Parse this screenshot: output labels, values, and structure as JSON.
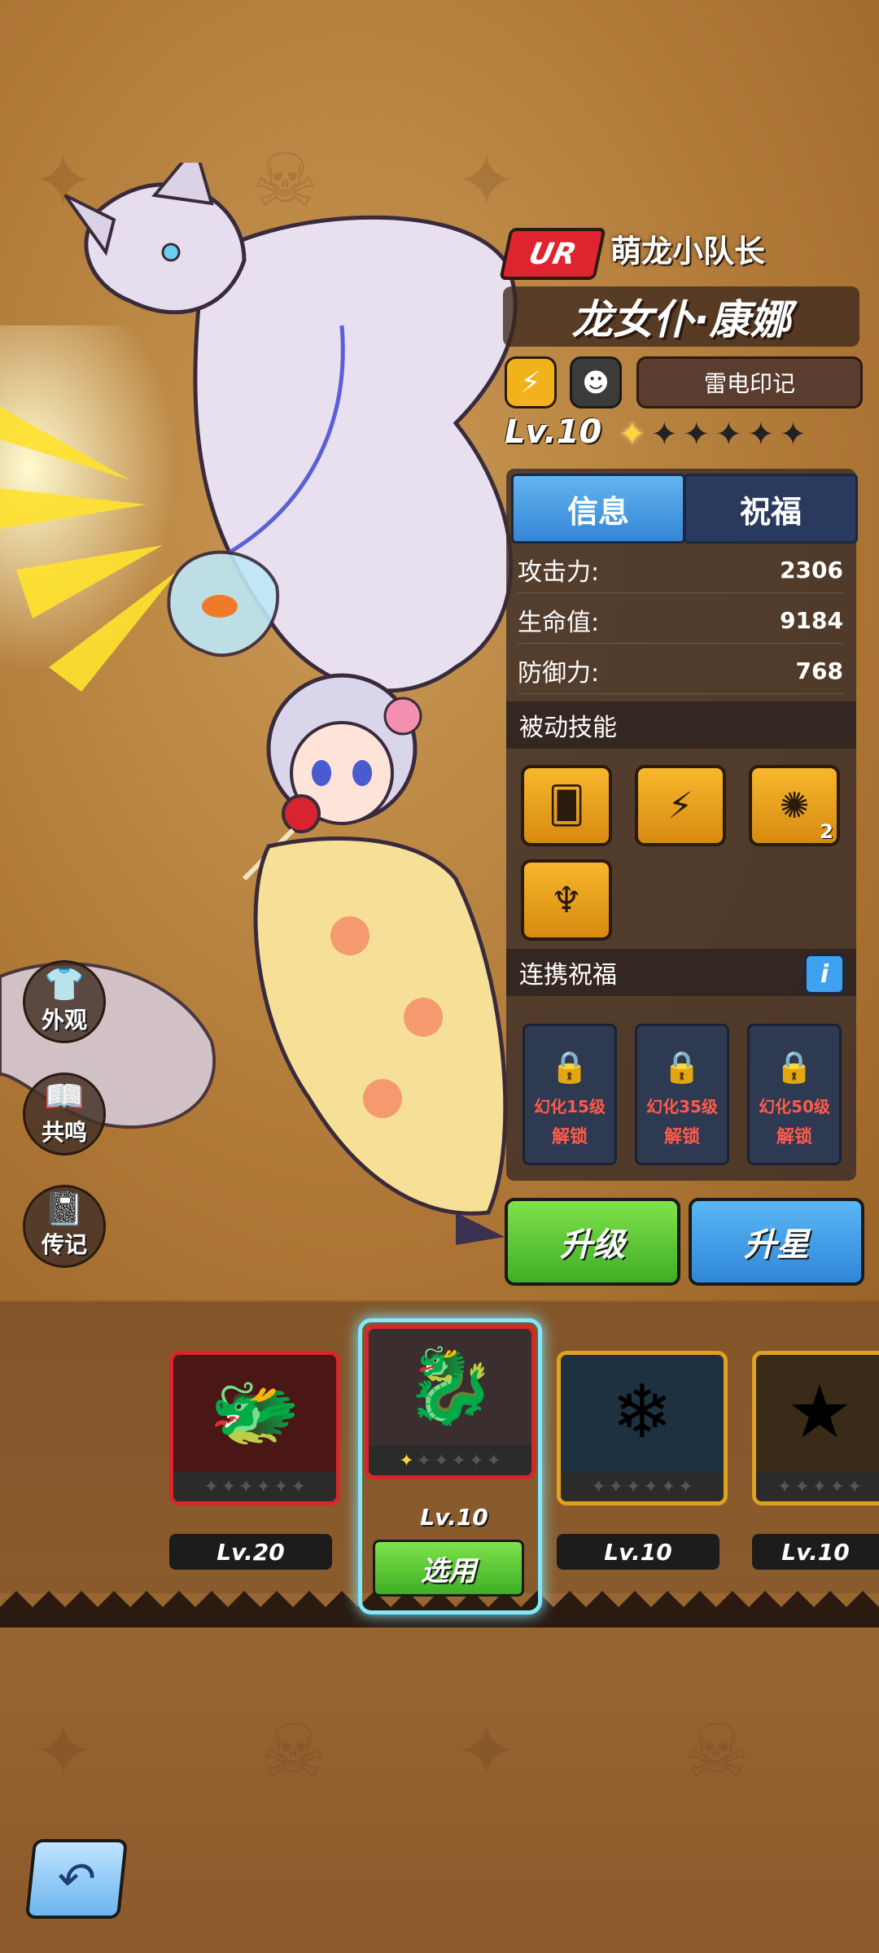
{
  "hero": {
    "rarity": "UR",
    "subtitle": "萌龙小队长",
    "name": "龙女仆·康娜",
    "element_icon": "lightning-icon",
    "class_icon": "beast-mask-icon",
    "mark": "雷电印记",
    "level": "Lv.10",
    "stars_filled": 1,
    "stars_total": 6
  },
  "tabs": {
    "info": "信息",
    "blessing": "祝福"
  },
  "stats": [
    {
      "label": "攻击力:",
      "value": "2306"
    },
    {
      "label": "生命值:",
      "value": "9184"
    },
    {
      "label": "防御力:",
      "value": "768"
    }
  ],
  "passive": {
    "title": "被动技能",
    "skills": [
      {
        "icon": "cards-dice-icon",
        "count": ""
      },
      {
        "icon": "lightning-burst-icon",
        "count": ""
      },
      {
        "icon": "shield-burst-icon",
        "count": "2"
      },
      {
        "icon": "horned-helmet-icon",
        "count": ""
      }
    ]
  },
  "link": {
    "title": "连携祝福",
    "info": "i",
    "locks": [
      {
        "l1": "幻化15级",
        "l2": "解锁"
      },
      {
        "l1": "幻化35级",
        "l2": "解锁"
      },
      {
        "l1": "幻化50级",
        "l2": "解锁"
      }
    ]
  },
  "buttons": {
    "upgrade": "升级",
    "star_up": "升星",
    "select": "选用"
  },
  "side": [
    {
      "label": "外观",
      "icon": "shirt-icon"
    },
    {
      "label": "共鸣",
      "icon": "book-icon"
    },
    {
      "label": "传记",
      "icon": "journal-icon"
    }
  ],
  "cards": [
    {
      "level": "Lv.20",
      "icon": "green-dragon-icon",
      "stars_on": 0
    },
    {
      "level": "Lv.10",
      "icon": "white-dragon-icon",
      "stars_on": 1
    },
    {
      "level": "Lv.10",
      "icon": "ice-beast-icon",
      "stars_on": 0
    },
    {
      "level": "Lv.10",
      "icon": "yellow-creature-icon",
      "stars_on": 0
    }
  ],
  "colors": {
    "accent_green": "#4fc22f",
    "accent_blue": "#3a90de",
    "rarity_red": "#e0242f"
  }
}
